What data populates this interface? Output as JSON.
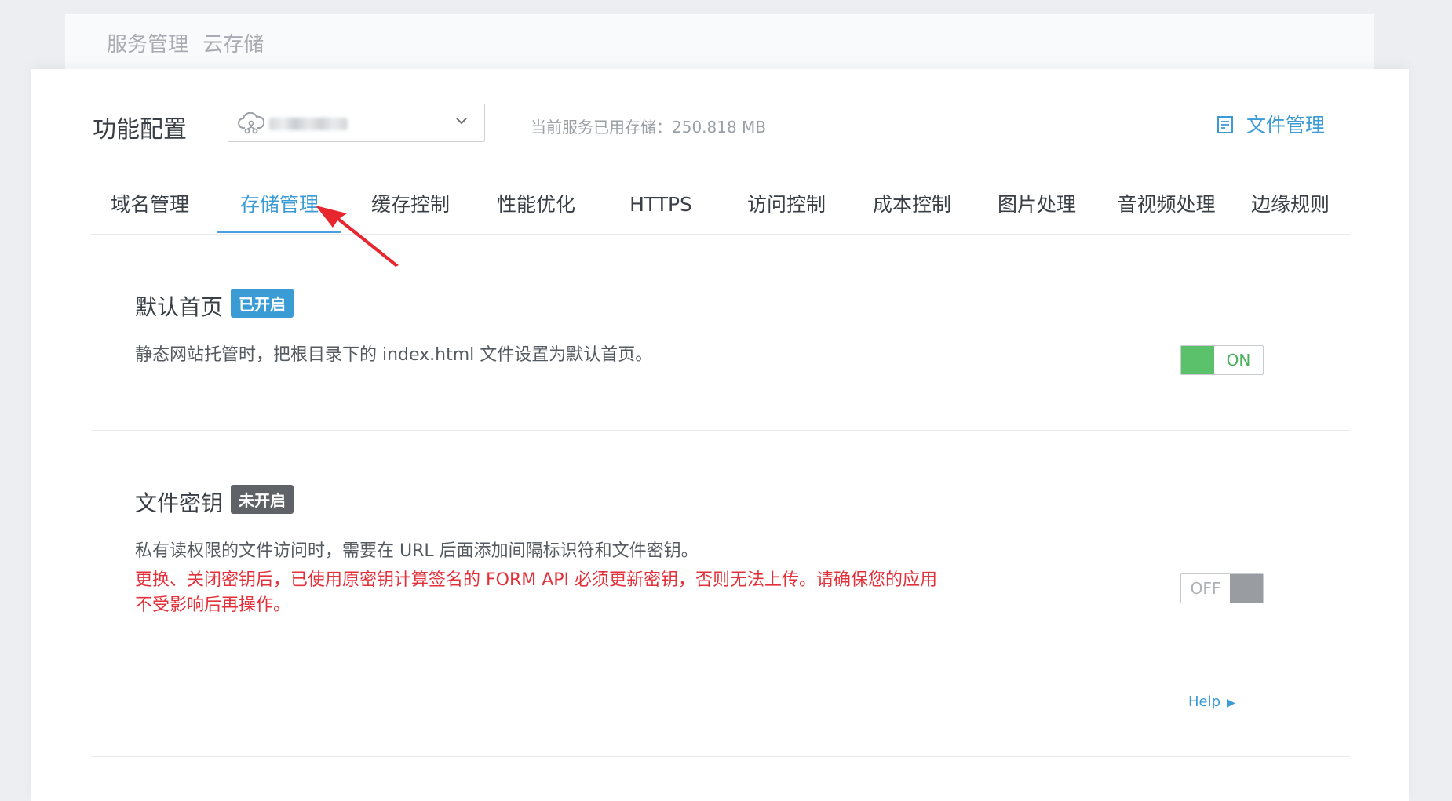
{
  "breadcrumb": [
    "服务管理",
    "云存储"
  ],
  "header": {
    "title": "功能配置",
    "service_select": {
      "value": ""
    },
    "usage_text": "当前服务已用存储：250.818 MB",
    "file_management_label": "文件管理"
  },
  "tabs": [
    {
      "label": "域名管理",
      "active": false
    },
    {
      "label": "存储管理",
      "active": true
    },
    {
      "label": "缓存控制",
      "active": false
    },
    {
      "label": "性能优化",
      "active": false
    },
    {
      "label": "HTTPS",
      "active": false
    },
    {
      "label": "访问控制",
      "active": false
    },
    {
      "label": "成本控制",
      "active": false
    },
    {
      "label": "图片处理",
      "active": false
    },
    {
      "label": "音视频处理",
      "active": false
    },
    {
      "label": "边缘规则",
      "active": false
    }
  ],
  "sections": [
    {
      "title": "默认首页",
      "badge": "已开启",
      "description": "静态网站托管时，把根目录下的 index.html 文件设置为默认首页。",
      "toggle_label": "ON",
      "enabled": true
    },
    {
      "title": "文件密钥",
      "badge": "未开启",
      "description": "私有读权限的文件访问时，需要在 URL 后面添加间隔标识符和文件密钥。",
      "warning": "更换、关闭密钥后，已使用原密钥计算签名的 FORM API 必须更新密钥，否则无法上传。请确保您的应用不受影响后再操作。",
      "toggle_label": "OFF",
      "enabled": false
    }
  ],
  "help_label": "Help",
  "colors": {
    "accent": "#3a9bd5",
    "toggle_on": "#5cc16b",
    "toggle_off": "#999ca0",
    "warning": "#e2313a",
    "annotation_arrow": "#e8262d"
  }
}
